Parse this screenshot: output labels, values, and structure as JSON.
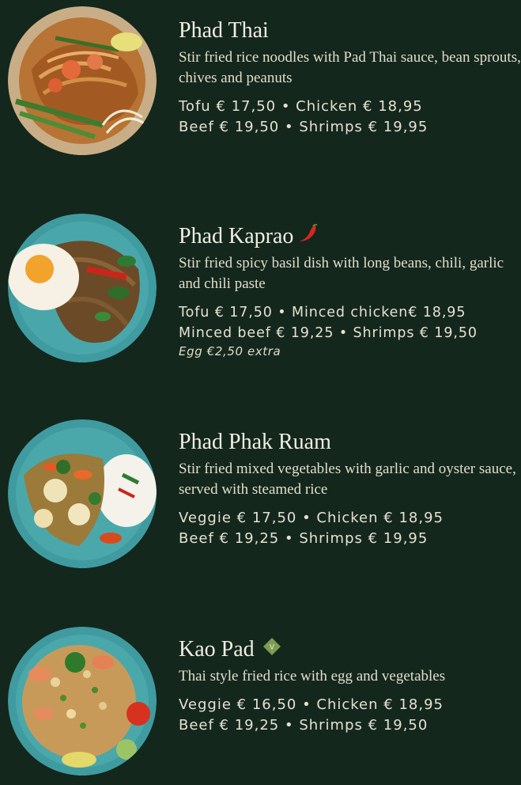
{
  "items": [
    {
      "name": "Phad Thai",
      "description": "Stir fried rice noodles with Pad Thai sauce, bean sprouts, chives and peanuts",
      "price_line_1": "Tofu € 17,50 • Chicken € 18,95",
      "price_line_2": "Beef € 19,50 • Shrimps € 19,95",
      "photo_icon": "noodle-dish-photo"
    },
    {
      "name": "Phad Kaprao",
      "description": "Stir fried spicy basil dish with long beans, chili, garlic and chili paste",
      "price_line_1": "Tofu € 17,50 • Minced chicken€ 18,95",
      "price_line_2": "Minced beef € 19,25 • Shrimps € 19,50",
      "extra": "Egg €2,50 extra",
      "badge_icon": "chili-icon",
      "badge_color": "#d9261c",
      "photo_icon": "basil-dish-photo"
    },
    {
      "name": "Phad Phak Ruam",
      "description": "Stir fried mixed vegetables with garlic and oyster sauce, served with steamed rice",
      "price_line_1": "Veggie € 17,50 • Chicken € 18,95",
      "price_line_2": "Beef € 19,25 • Shrimps € 19,95",
      "photo_icon": "vegetable-dish-photo"
    },
    {
      "name": "Kao Pad",
      "description": "Thai style fried rice with egg and vegetables",
      "price_line_1": "Veggie € 16,50 • Chicken € 18,95",
      "price_line_2": "Beef € 19,25 • Shrimps € 19,50",
      "badge_icon": "vegetarian-icon",
      "badge_text": "V",
      "badge_color": "#7f9a52",
      "photo_icon": "fried-rice-photo"
    }
  ],
  "colors": {
    "background": "#13271d",
    "text": "#ece7d8"
  }
}
